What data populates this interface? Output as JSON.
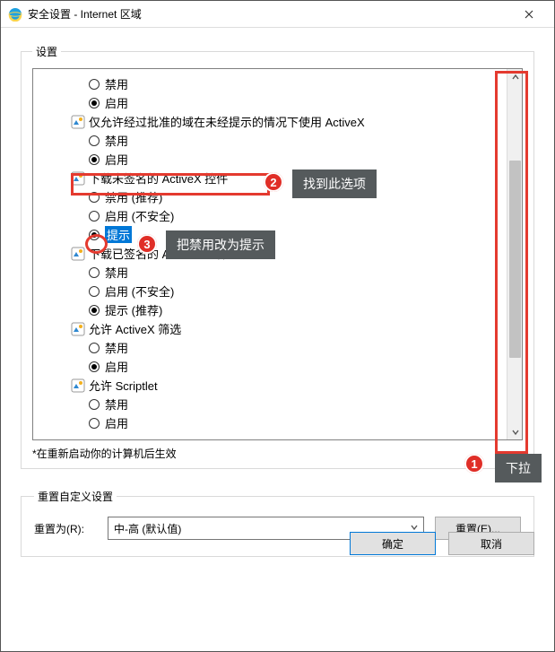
{
  "window": {
    "title": "安全设置 - Internet 区域"
  },
  "settings": {
    "legend": "设置",
    "footnote": "*在重新启动你的计算机后生效",
    "items": [
      {
        "type": "opt",
        "label": "禁用",
        "selected": false
      },
      {
        "type": "opt",
        "label": "启用",
        "selected": true
      },
      {
        "type": "hdr",
        "label": "仅允许经过批准的域在未经提示的情况下使用 ActiveX"
      },
      {
        "type": "opt",
        "label": "禁用",
        "selected": false
      },
      {
        "type": "opt",
        "label": "启用",
        "selected": true
      },
      {
        "type": "hdr",
        "label": "下载未签名的 ActiveX 控件"
      },
      {
        "type": "opt",
        "label": "禁用 (推荐)",
        "selected": false
      },
      {
        "type": "opt",
        "label": "启用 (不安全)",
        "selected": false
      },
      {
        "type": "opt",
        "label": "提示",
        "selected": true,
        "highlight_sel": true
      },
      {
        "type": "hdr",
        "label": "下载已签名的 ActiveX 控件"
      },
      {
        "type": "opt",
        "label": "禁用",
        "selected": false
      },
      {
        "type": "opt",
        "label": "启用 (不安全)",
        "selected": false
      },
      {
        "type": "opt",
        "label": "提示 (推荐)",
        "selected": true
      },
      {
        "type": "hdr",
        "label": "允许 ActiveX 筛选"
      },
      {
        "type": "opt",
        "label": "禁用",
        "selected": false
      },
      {
        "type": "opt",
        "label": "启用",
        "selected": true
      },
      {
        "type": "hdr",
        "label": "允许 Scriptlet"
      },
      {
        "type": "opt",
        "label": "禁用",
        "selected": false
      },
      {
        "type": "opt",
        "label": "启用",
        "selected": false
      }
    ]
  },
  "reset": {
    "legend": "重置自定义设置",
    "label": "重置为(R):",
    "value": "中-高 (默认值)",
    "button": "重置(E)..."
  },
  "buttons": {
    "ok": "确定",
    "cancel": "取消"
  },
  "annotations": {
    "tip1": "下拉",
    "tip2": "找到此选项",
    "tip3": "把禁用改为提示",
    "b1": "1",
    "b2": "2",
    "b3": "3"
  }
}
